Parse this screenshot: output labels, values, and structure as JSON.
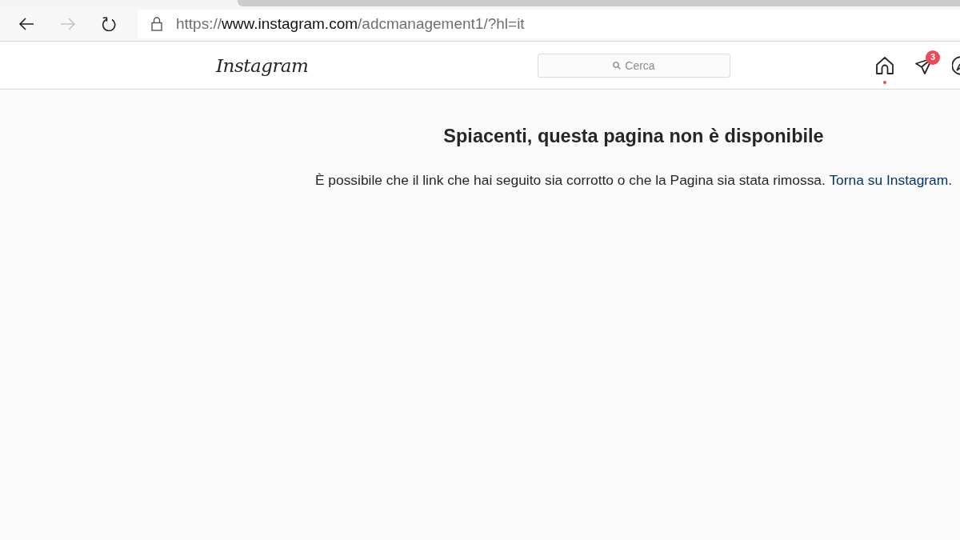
{
  "browser": {
    "nav_buttons": [
      {
        "kind": "back",
        "disabled": false
      },
      {
        "kind": "forward",
        "disabled": true
      },
      {
        "kind": "reload",
        "disabled": false
      }
    ],
    "address": {
      "scheme": "https://",
      "host": "www.instagram.com",
      "path": "/adcmanagement1/?hl=it"
    }
  },
  "header": {
    "logo": "Instagram",
    "search": {
      "placeholder": "Cerca"
    },
    "nav_icons": [
      {
        "kind": "home",
        "dot": true
      },
      {
        "kind": "direct",
        "dot": false,
        "badge": "3"
      },
      {
        "kind": "explore",
        "dot": false
      }
    ]
  },
  "content": {
    "title": "Spiacenti, questa pagina non è disponibile",
    "message": "È possibile che il link che hai seguito sia corrotto o che la Pagina sia stata rimossa.",
    "link": "Torna su Instagram."
  }
}
